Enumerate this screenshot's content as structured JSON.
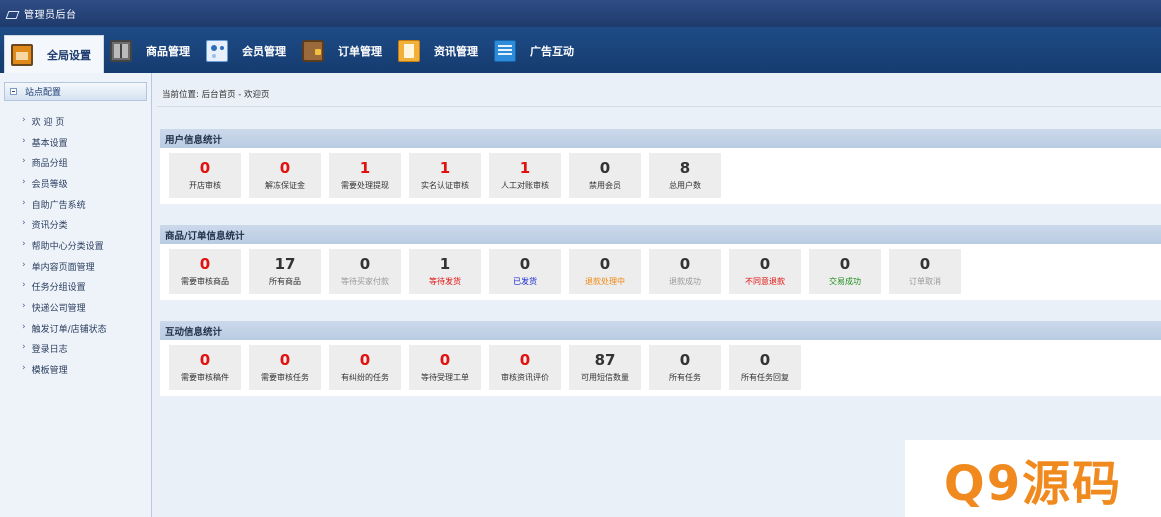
{
  "app": {
    "title": "管理员后台"
  },
  "nav": {
    "items": [
      {
        "label": "全局设置",
        "icon": "home-settings-icon",
        "active": true
      },
      {
        "label": "商品管理",
        "icon": "goods-icon"
      },
      {
        "label": "会员管理",
        "icon": "member-icon"
      },
      {
        "label": "订单管理",
        "icon": "order-icon"
      },
      {
        "label": "资讯管理",
        "icon": "news-icon"
      },
      {
        "label": "广告互动",
        "icon": "ad-icon"
      }
    ]
  },
  "sidebar": {
    "title": "站点配置",
    "items": [
      {
        "label": "欢 迎 页"
      },
      {
        "label": "基本设置"
      },
      {
        "label": "商品分组"
      },
      {
        "label": "会员等级"
      },
      {
        "label": "自助广告系统"
      },
      {
        "label": "资讯分类"
      },
      {
        "label": "帮助中心分类设置"
      },
      {
        "label": "单内容页面管理"
      },
      {
        "label": "任务分组设置"
      },
      {
        "label": "快递公司管理"
      },
      {
        "label": "触发订单/店铺状态"
      },
      {
        "label": "登录日志"
      },
      {
        "label": "模板管理"
      }
    ]
  },
  "breadcrumb": {
    "text": "当前位置: 后台首页 - 欢迎页"
  },
  "sections": [
    {
      "title": "用户信息统计",
      "stats": [
        {
          "value": "0",
          "label": "开店审核"
        },
        {
          "value": "0",
          "label": "解冻保证金"
        },
        {
          "value": "1",
          "label": "需要处理提现"
        },
        {
          "value": "1",
          "label": "实名认证审核"
        },
        {
          "value": "1",
          "label": "人工对账审核"
        },
        {
          "value": "0",
          "label": "禁用会员"
        },
        {
          "value": "8",
          "label": "总用户数"
        }
      ]
    },
    {
      "title": "商品/订单信息统计",
      "stats": [
        {
          "value": "0",
          "label": "需要审核商品"
        },
        {
          "value": "17",
          "label": "所有商品"
        },
        {
          "value": "0",
          "label": "等待买家付款"
        },
        {
          "value": "1",
          "label": "等待发货"
        },
        {
          "value": "0",
          "label": "已发货"
        },
        {
          "value": "0",
          "label": "退款处理中"
        },
        {
          "value": "0",
          "label": "退款成功"
        },
        {
          "value": "0",
          "label": "不同意退款"
        },
        {
          "value": "0",
          "label": "交易成功"
        },
        {
          "value": "0",
          "label": "订单取消"
        }
      ]
    },
    {
      "title": "互动信息统计",
      "stats": [
        {
          "value": "0",
          "label": "需要审核稿件"
        },
        {
          "value": "0",
          "label": "需要审核任务"
        },
        {
          "value": "0",
          "label": "有纠纷的任务"
        },
        {
          "value": "0",
          "label": "等待受理工单"
        },
        {
          "value": "0",
          "label": "审核资讯评价"
        },
        {
          "value": "87",
          "label": "可用短信数量"
        },
        {
          "value": "0",
          "label": "所有任务"
        },
        {
          "value": "0",
          "label": "所有任务回复"
        }
      ]
    }
  ],
  "colors": {
    "header": "#1f3a6c",
    "accent_red": "#e0120f",
    "section_title_bg": "#c3d4e8"
  },
  "watermark": {
    "text": "Q9源码"
  }
}
